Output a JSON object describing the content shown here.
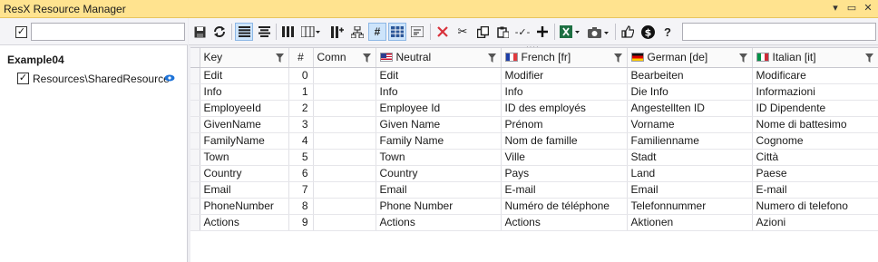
{
  "window": {
    "title": "ResX Resource Manager"
  },
  "titlebar_buttons": {
    "menu": "▾",
    "restore": "▭",
    "close": "✕"
  },
  "left_panel": {
    "select_all_checked": "✓",
    "filter_value": "",
    "tree": {
      "root_label": "Example04",
      "items": [
        {
          "label": "Resources\\SharedResource",
          "checked": "✓"
        }
      ]
    }
  },
  "toolbar": {
    "icons": [
      "save-icon",
      "refresh-icon",
      "align-left-icon",
      "align-justify-icon",
      "columns-icon",
      "column-chooser-icon",
      "add-column-icon",
      "tree-icon",
      "number-icon",
      "grid-icon",
      "text-wrap-icon",
      "delete-icon",
      "cut-icon",
      "copy-icon",
      "paste-icon",
      "translate-icon",
      "add-icon",
      "excel-icon",
      "screenshot-icon",
      "like-icon",
      "donate-icon",
      "help-icon"
    ],
    "search_value": ""
  },
  "grid": {
    "columns": [
      "Key",
      "#",
      "Comn",
      "Neutral",
      "French [fr]",
      "German [de]",
      "Italian [it]"
    ],
    "rows": [
      [
        "Edit",
        "0",
        "",
        "Edit",
        "Modifier",
        "Bearbeiten",
        "Modificare"
      ],
      [
        "Info",
        "1",
        "",
        "Info",
        "Info",
        "Die Info",
        "Informazioni"
      ],
      [
        "EmployeeId",
        "2",
        "",
        "Employee Id",
        "ID des employés",
        "Angestellten ID",
        "ID Dipendente"
      ],
      [
        "GivenName",
        "3",
        "",
        "Given Name",
        "Prénom",
        "Vorname",
        "Nome di battesimo"
      ],
      [
        "FamilyName",
        "4",
        "",
        "Family Name",
        "Nom de famille",
        "Familienname",
        "Cognome"
      ],
      [
        "Town",
        "5",
        "",
        "Town",
        "Ville",
        "Stadt",
        "Città"
      ],
      [
        "Country",
        "6",
        "",
        "Country",
        "Pays",
        "Land",
        "Paese"
      ],
      [
        "Email",
        "7",
        "",
        "Email",
        "E-mail",
        "Email",
        "E-mail"
      ],
      [
        "PhoneNumber",
        "8",
        "",
        "Phone Number",
        "Numéro de téléphone",
        "Telefonnummer",
        "Numero di telefono"
      ],
      [
        "Actions",
        "9",
        "",
        "Actions",
        "Actions",
        "Aktionen",
        "Azioni"
      ]
    ]
  },
  "colors": {
    "titlebar": "#ffe38f",
    "accent": "#1e73d8",
    "excel": "#1d6f42",
    "delete": "#d8303a"
  }
}
